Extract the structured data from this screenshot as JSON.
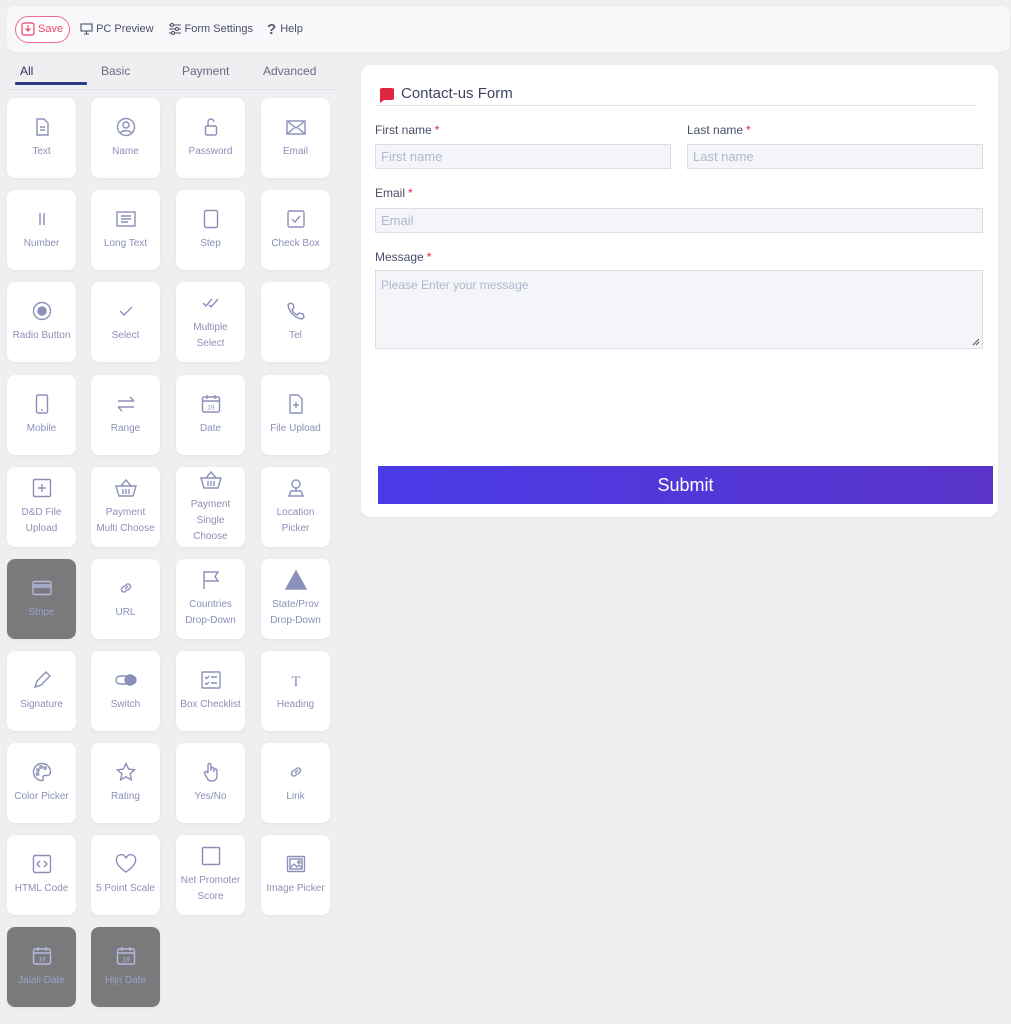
{
  "toolbar": {
    "save_label": "Save",
    "preview_label": "PC Preview",
    "settings_label": "Form Settings",
    "help_label": "Help"
  },
  "tabs": [
    {
      "label": "All",
      "active": true
    },
    {
      "label": "Basic",
      "active": false
    },
    {
      "label": "Payment",
      "active": false
    },
    {
      "label": "Advanced",
      "active": false
    }
  ],
  "palette": [
    {
      "label": "Text",
      "icon": "document-icon",
      "disabled": false
    },
    {
      "label": "Name",
      "icon": "user-icon",
      "disabled": false
    },
    {
      "label": "Password",
      "icon": "lock-icon",
      "disabled": false
    },
    {
      "label": "Email",
      "icon": "envelope-icon",
      "disabled": false
    },
    {
      "label": "Number",
      "icon": "number-icon",
      "disabled": false
    },
    {
      "label": "Long Text",
      "icon": "textarea-icon",
      "disabled": false
    },
    {
      "label": "Step",
      "icon": "step-icon",
      "disabled": false
    },
    {
      "label": "Check Box",
      "icon": "checkbox-icon",
      "disabled": false
    },
    {
      "label": "Radio Button",
      "icon": "radio-icon",
      "disabled": false
    },
    {
      "label": "Select",
      "icon": "check-icon",
      "disabled": false
    },
    {
      "label": "Multiple Select",
      "icon": "double-check-icon",
      "disabled": false
    },
    {
      "label": "Tel",
      "icon": "phone-icon",
      "disabled": false
    },
    {
      "label": "Mobile",
      "icon": "mobile-icon",
      "disabled": false
    },
    {
      "label": "Range",
      "icon": "range-icon",
      "disabled": false
    },
    {
      "label": "Date",
      "icon": "calendar-icon",
      "disabled": false
    },
    {
      "label": "File Upload",
      "icon": "file-upload-icon",
      "disabled": false
    },
    {
      "label": "D&D File Upload",
      "icon": "dnd-upload-icon",
      "disabled": false
    },
    {
      "label": "Payment Multi Choose",
      "icon": "basket-icon",
      "disabled": false
    },
    {
      "label": "Payment Single Choose",
      "icon": "basket-icon",
      "disabled": false
    },
    {
      "label": "Location Picker",
      "icon": "location-icon",
      "disabled": false
    },
    {
      "label": "Stripe",
      "icon": "credit-card-icon",
      "disabled": true
    },
    {
      "label": "URL",
      "icon": "link-icon",
      "disabled": false
    },
    {
      "label": "Countries Drop-Down",
      "icon": "flag-icon",
      "disabled": false
    },
    {
      "label": "State/Prov Drop-Down",
      "icon": "triangle-icon",
      "disabled": false
    },
    {
      "label": "Signature",
      "icon": "pen-icon",
      "disabled": false
    },
    {
      "label": "Switch",
      "icon": "toggle-icon",
      "disabled": false
    },
    {
      "label": "Box Checklist",
      "icon": "checklist-icon",
      "disabled": false
    },
    {
      "label": "Heading",
      "icon": "heading-icon",
      "disabled": false
    },
    {
      "label": "Color Picker",
      "icon": "palette-icon",
      "disabled": false
    },
    {
      "label": "Rating",
      "icon": "star-icon",
      "disabled": false
    },
    {
      "label": "Yes/No",
      "icon": "pointer-hand-icon",
      "disabled": false
    },
    {
      "label": "Link",
      "icon": "link-icon",
      "disabled": false
    },
    {
      "label": "HTML Code",
      "icon": "code-icon",
      "disabled": false
    },
    {
      "label": "5 Point Scale",
      "icon": "heart-icon",
      "disabled": false
    },
    {
      "label": "Net Promoter Score",
      "icon": "square-icon",
      "disabled": false
    },
    {
      "label": "Image Picker",
      "icon": "image-icon",
      "disabled": false
    },
    {
      "label": "Jalali Date",
      "icon": "calendar-icon",
      "disabled": true
    },
    {
      "label": "Hijri Date",
      "icon": "calendar-icon",
      "disabled": true
    }
  ],
  "form": {
    "title": "Contact-us Form",
    "first_name": {
      "label": "First name",
      "required": "*",
      "placeholder": "First name"
    },
    "last_name": {
      "label": "Last name",
      "required": "*",
      "placeholder": "Last name"
    },
    "email": {
      "label": "Email",
      "required": "*",
      "placeholder": "Email"
    },
    "message": {
      "label": "Message",
      "required": "*",
      "placeholder": "Please Enter your message"
    },
    "submit_label": "Submit"
  },
  "colors": {
    "accent": "#2e3a8c",
    "save_border": "#f06a8c",
    "required_mark": "#e0263f",
    "submit_gradient_start": "#4a3ae8",
    "submit_gradient_end": "#5a34c9"
  }
}
